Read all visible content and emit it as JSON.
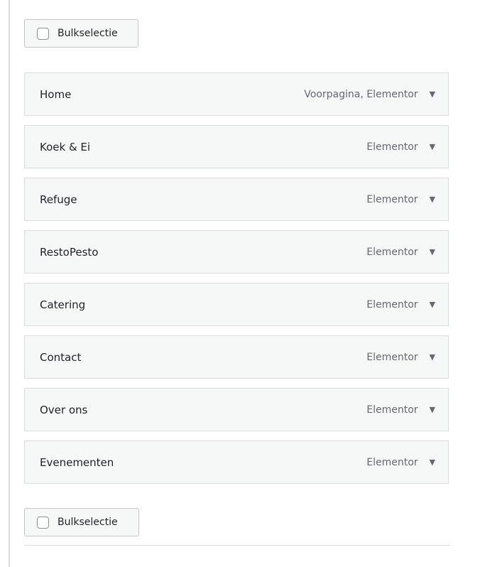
{
  "bulk_select_label": "Bulkselectie",
  "pages": [
    {
      "title": "Home",
      "state": "Voorpagina, Elementor"
    },
    {
      "title": "Koek & Ei",
      "state": "Elementor"
    },
    {
      "title": "Refuge",
      "state": "Elementor"
    },
    {
      "title": "RestoPesto",
      "state": "Elementor"
    },
    {
      "title": "Catering",
      "state": "Elementor"
    },
    {
      "title": "Contact",
      "state": "Elementor"
    },
    {
      "title": "Over ons",
      "state": "Elementor"
    },
    {
      "title": "Evenementen",
      "state": "Elementor"
    }
  ],
  "icons": {
    "checkbox": "checkbox-icon",
    "expand": "caret-down-icon"
  }
}
